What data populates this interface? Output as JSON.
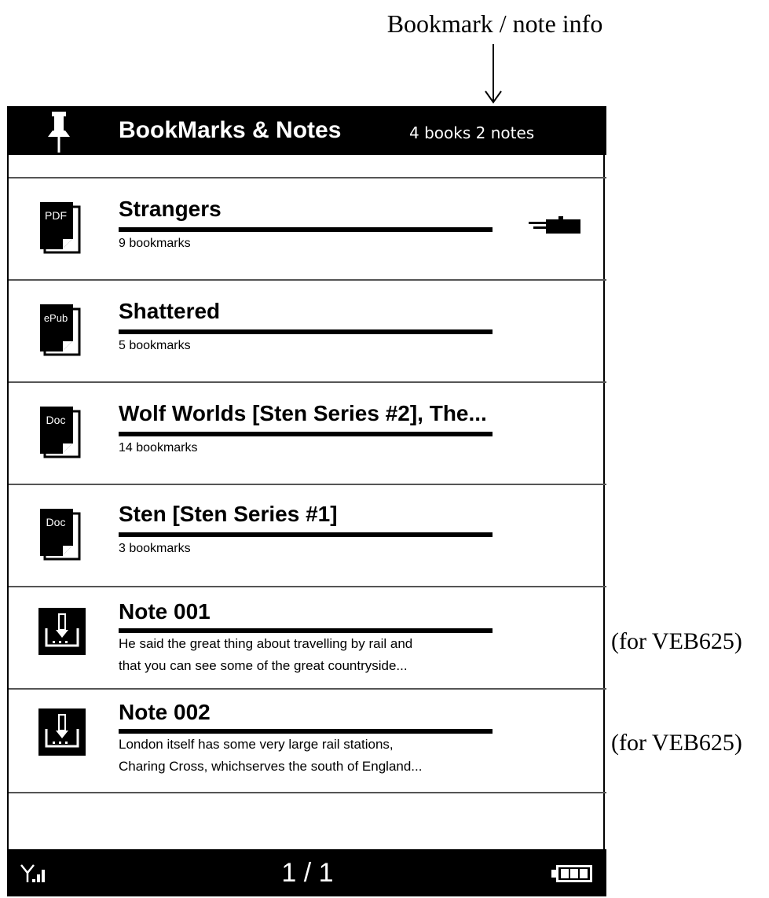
{
  "annotations": {
    "top": "Bookmark / note info",
    "side": [
      "(for VEB625)",
      "(for VEB625)"
    ]
  },
  "header": {
    "title": "BookMarks & Notes",
    "info": "4 books 2 notes",
    "icon": "pushpin-icon"
  },
  "items": [
    {
      "type": "book",
      "badge": "PDF",
      "title": "Strangers",
      "subtitle": "9 bookmarks"
    },
    {
      "type": "book",
      "badge": "ePub",
      "title": "Shattered",
      "subtitle": "5 bookmarks"
    },
    {
      "type": "book",
      "badge": "Doc",
      "title": "Wolf Worlds [Sten Series #2], The...",
      "subtitle": "14 bookmarks"
    },
    {
      "type": "book",
      "badge": "Doc",
      "title": "Sten [Sten Series #1]",
      "subtitle": "3 bookmarks"
    },
    {
      "type": "note",
      "title": "Note 001",
      "lines": [
        "He said the great thing about travelling by rail and",
        "that you can see some of the great countryside..."
      ]
    },
    {
      "type": "note",
      "title": "Note 002",
      "lines": [
        "London itself has some very large rail stations,",
        "Charing Cross, whichserves the south of England..."
      ]
    }
  ],
  "footer": {
    "page": "1 / 1",
    "signal_icon": "signal-icon",
    "battery_icon": "battery-icon"
  },
  "colors": {
    "bar": "#000000",
    "background": "#ffffff"
  }
}
